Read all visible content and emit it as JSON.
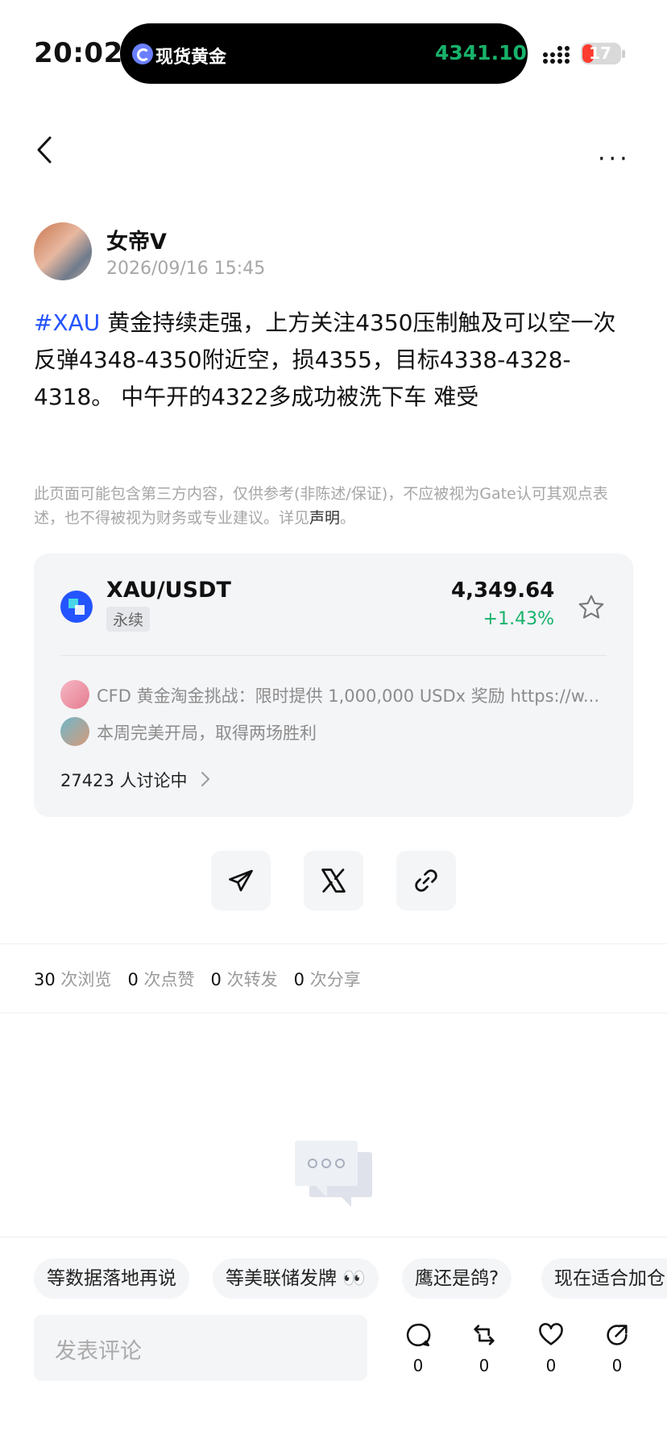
{
  "status": {
    "time": "20:02",
    "battery": "17"
  },
  "island": {
    "label": "现货黄金",
    "price": "4341.10"
  },
  "post": {
    "author": "女帝V",
    "date": "2026/09/16 15:45",
    "tag": "#XAU",
    "body": " 黄金持续走强，上方关注4350压制触及可以空一次反弹4348-4350附近空，损4355，目标4338-4328-4318。 中午开的4322多成功被洗下车 难受",
    "disclaimer": "此页面可能包含第三方内容，仅供参考(非陈述/保证)，不应被视为Gate认可其观点表述，也不得被视为财务或专业建议。详见",
    "disclaimer_link": "声明",
    "disclaimer_end": "。"
  },
  "card": {
    "pair": "XAU/USDT",
    "type": "永续",
    "price": "4,349.64",
    "change": "+1.43%",
    "sub1": "CFD 黄金淘金挑战：限时提供 1,000,000 USDx 奖励 https://w...",
    "sub2": "本周完美开局，取得两场胜利",
    "discuss": "27423 人讨论中"
  },
  "stats": {
    "views": "30",
    "views_label": "次浏览",
    "likes": "0",
    "likes_label": "次点赞",
    "reposts": "0",
    "reposts_label": "次转发",
    "shares": "0",
    "shares_label": "次分享"
  },
  "chips": [
    "等数据落地再说",
    "等美联储发牌 👀",
    "鹰还是鸽?",
    "现在适合加仓"
  ],
  "comment": {
    "placeholder": "发表评论"
  },
  "actions": {
    "comment": "0",
    "repost": "0",
    "like": "0",
    "share": "0"
  },
  "icons": [
    "back-icon",
    "more-icon",
    "star-icon",
    "telegram-icon",
    "x-icon",
    "link-icon",
    "comment-icon",
    "repost-icon",
    "like-icon",
    "share-icon"
  ],
  "colors": {
    "accent": "#2454ff",
    "up": "#18b26b"
  }
}
